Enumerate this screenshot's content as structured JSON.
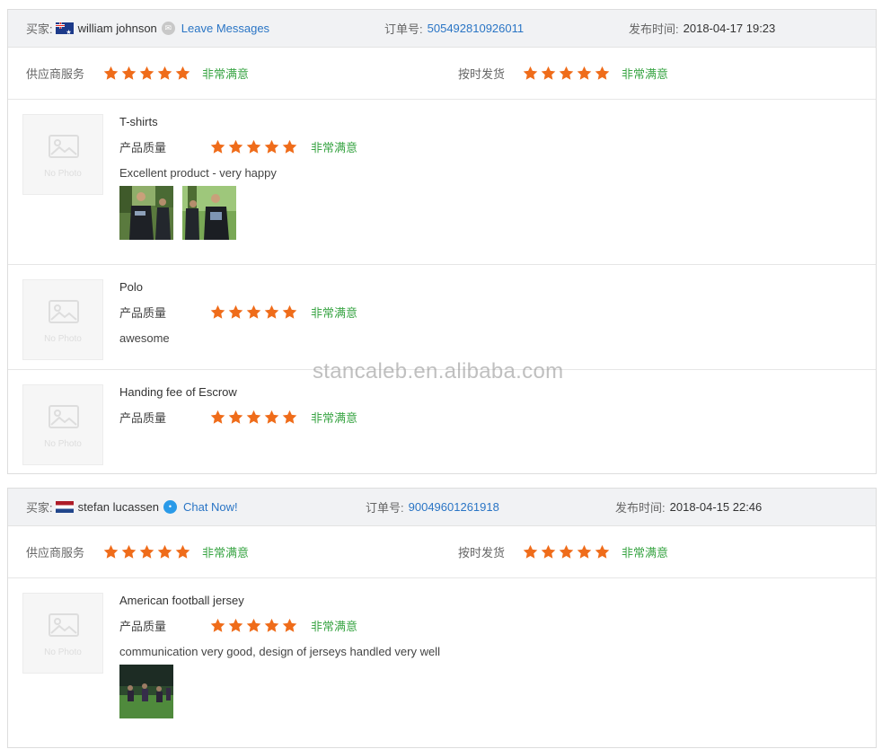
{
  "colors": {
    "star": "#ef6c1a",
    "satisfied": "#3aa545",
    "link": "#2a75c5",
    "header_bg": "#f1f2f4"
  },
  "labels": {
    "buyer": "买家:",
    "order_no": "订单号:",
    "posted_time": "发布时间:",
    "supplier_service": "供应商服务",
    "on_time_delivery": "按时发货",
    "product_quality": "产品质量",
    "very_satisfied": "非常满意",
    "no_photo": "No Photo"
  },
  "reviews": [
    {
      "buyer": "william johnson",
      "country_flag": "australia-flag-icon",
      "contact_icon": "message-icon",
      "contact_label": "Leave Messages",
      "order_no": "505492810926011",
      "posted": "2018-04-17 19:23",
      "supplier_service_rating": 5,
      "on_time_delivery_rating": 5,
      "items": [
        {
          "name": "T-shirts",
          "quality_rating": 5,
          "comment": "Excellent product - very happy",
          "photo_count": 2
        },
        {
          "name": "Polo",
          "quality_rating": 5,
          "comment": "awesome",
          "photo_count": 0
        },
        {
          "name": "Handing fee of Escrow",
          "quality_rating": 5,
          "comment": "",
          "photo_count": 0
        }
      ]
    },
    {
      "buyer": "stefan lucassen",
      "country_flag": "netherlands-flag-icon",
      "contact_icon": "chat-icon",
      "contact_label": "Chat Now!",
      "order_no": "90049601261918",
      "posted": "2018-04-15 22:46",
      "supplier_service_rating": 5,
      "on_time_delivery_rating": 5,
      "items": [
        {
          "name": "American football jersey",
          "quality_rating": 5,
          "comment": "communication very good, design of jerseys handled very well",
          "photo_count": 1
        }
      ]
    }
  ],
  "watermark": "stancaleb.en.alibaba.com"
}
